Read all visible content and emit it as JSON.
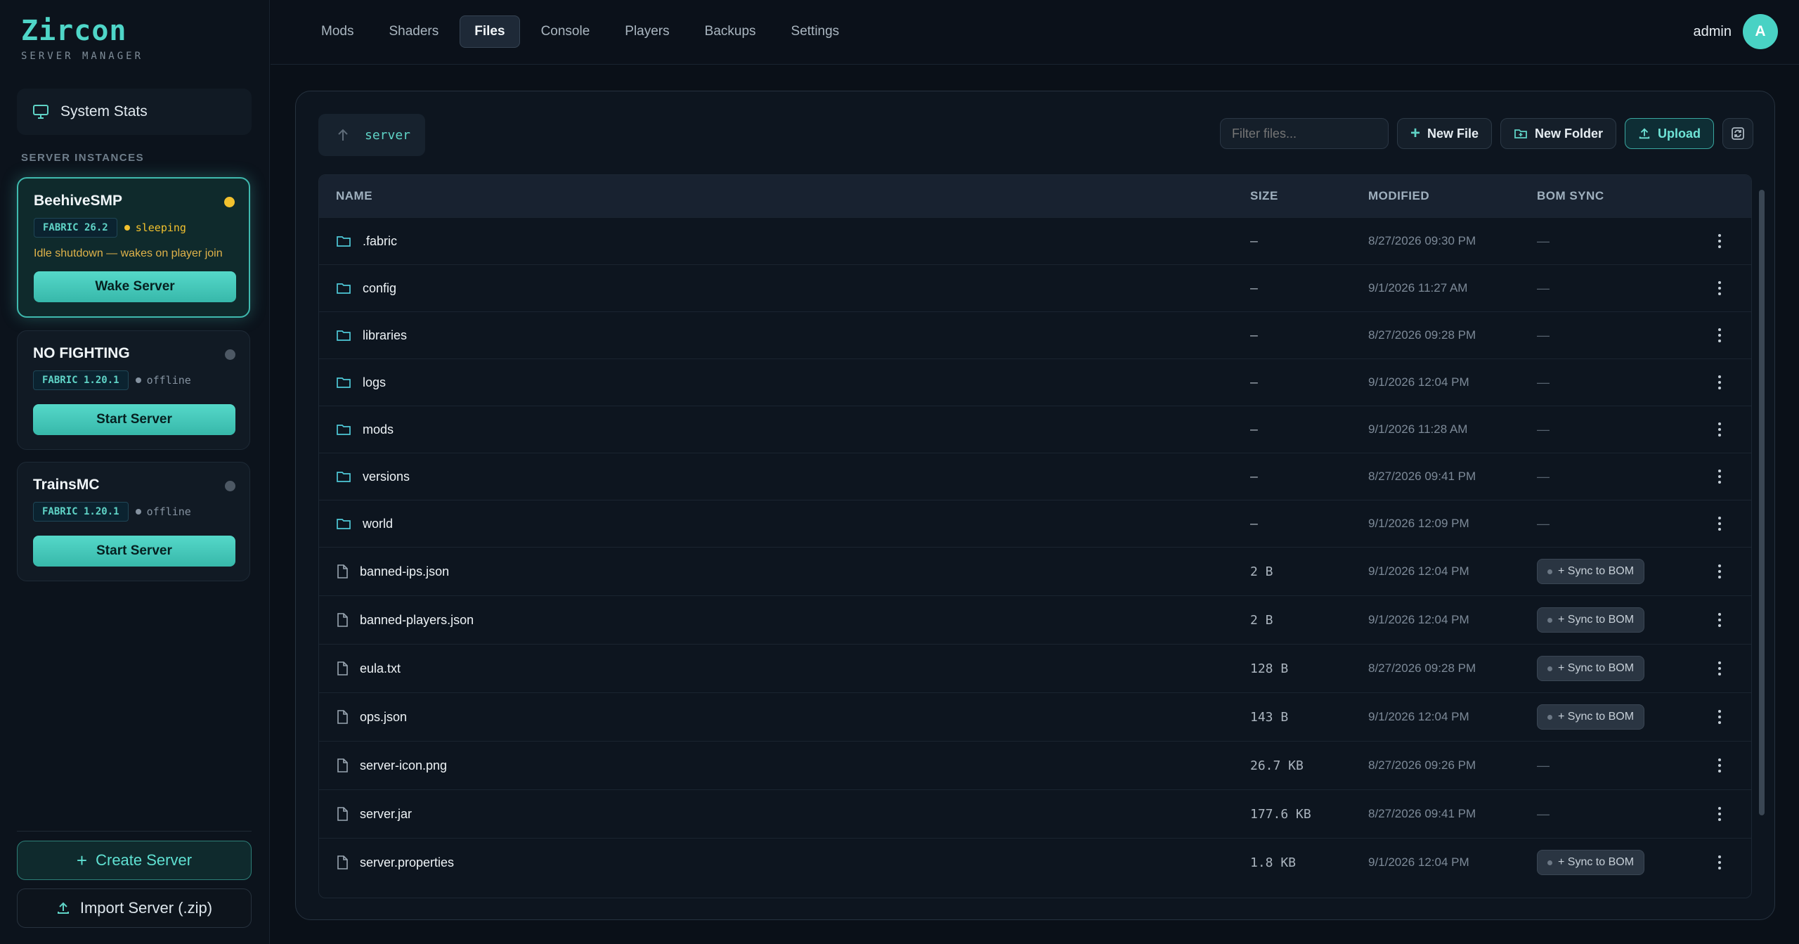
{
  "brand": {
    "name": "Zircon",
    "subtitle": "SERVER MANAGER"
  },
  "sidebar": {
    "system_stats_label": "System Stats",
    "section_title": "SERVER INSTANCES",
    "servers": [
      {
        "name": "BeehiveSMP",
        "version": "FABRIC 26.2",
        "state": "sleeping",
        "note": "Idle shutdown — wakes on player join",
        "button": "Wake Server",
        "dot_color": "#f2c12e",
        "state_color": "#f2c12e"
      },
      {
        "name": "NO FIGHTING",
        "version": "FABRIC 1.20.1",
        "state": "offline",
        "button": "Start Server",
        "dot_color": "#4d5864",
        "state_color": "#8592a0"
      },
      {
        "name": "TrainsMC",
        "version": "FABRIC 1.20.1",
        "state": "offline",
        "button": "Start Server",
        "dot_color": "#4d5864",
        "state_color": "#8592a0"
      }
    ],
    "create_label": "Create Server",
    "import_label": "Import Server (.zip)"
  },
  "nav": {
    "tabs": [
      "Mods",
      "Shaders",
      "Files",
      "Console",
      "Players",
      "Backups",
      "Settings"
    ],
    "active": "Files",
    "user": "admin",
    "avatar_initial": "A"
  },
  "files": {
    "path": "server",
    "filter_placeholder": "Filter files...",
    "buttons": {
      "new_file": "New File",
      "new_folder": "New Folder",
      "upload": "Upload"
    },
    "columns": {
      "name": "NAME",
      "size": "SIZE",
      "modified": "MODIFIED",
      "bom": "BOM SYNC"
    },
    "rows": [
      {
        "name": ".fabric",
        "type": "folder",
        "size": "–",
        "modified": "8/27/2026 09:30 PM",
        "bom": "—"
      },
      {
        "name": "config",
        "type": "folder",
        "size": "–",
        "modified": "9/1/2026 11:27 AM",
        "bom": "—"
      },
      {
        "name": "libraries",
        "type": "folder",
        "size": "–",
        "modified": "8/27/2026 09:28 PM",
        "bom": "—"
      },
      {
        "name": "logs",
        "type": "folder",
        "size": "–",
        "modified": "9/1/2026 12:04 PM",
        "bom": "—"
      },
      {
        "name": "mods",
        "type": "folder",
        "size": "–",
        "modified": "9/1/2026 11:28 AM",
        "bom": "—"
      },
      {
        "name": "versions",
        "type": "folder",
        "size": "–",
        "modified": "8/27/2026 09:41 PM",
        "bom": "—"
      },
      {
        "name": "world",
        "type": "folder",
        "size": "–",
        "modified": "9/1/2026 12:09 PM",
        "bom": "—"
      },
      {
        "name": "banned-ips.json",
        "type": "file",
        "size": "2 B",
        "modified": "9/1/2026 12:04 PM",
        "bom": "+ Sync to BOM"
      },
      {
        "name": "banned-players.json",
        "type": "file",
        "size": "2 B",
        "modified": "9/1/2026 12:04 PM",
        "bom": "+ Sync to BOM"
      },
      {
        "name": "eula.txt",
        "type": "file",
        "size": "128 B",
        "modified": "8/27/2026 09:28 PM",
        "bom": "+ Sync to BOM"
      },
      {
        "name": "ops.json",
        "type": "file",
        "size": "143 B",
        "modified": "9/1/2026 12:04 PM",
        "bom": "+ Sync to BOM"
      },
      {
        "name": "server-icon.png",
        "type": "file",
        "size": "26.7 KB",
        "modified": "8/27/2026 09:26 PM",
        "bom": "—"
      },
      {
        "name": "server.jar",
        "type": "file",
        "size": "177.6 KB",
        "modified": "8/27/2026 09:41 PM",
        "bom": "—"
      },
      {
        "name": "server.properties",
        "type": "file",
        "size": "1.8 KB",
        "modified": "9/1/2026 12:04 PM",
        "bom": "+ Sync to BOM"
      }
    ]
  }
}
